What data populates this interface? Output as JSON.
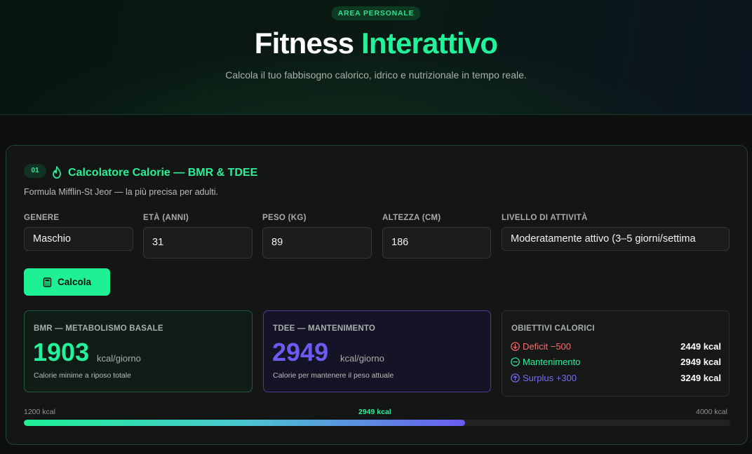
{
  "hero": {
    "badge": "AREA PERSONALE",
    "title_main": "Fitness",
    "title_accent": "Interattivo",
    "subtitle": "Calcola il tuo fabbisogno calorico, idrico e nutrizionale in tempo reale."
  },
  "calculator": {
    "step": "01",
    "icon": "flame-icon",
    "title": "Calcolatore Calorie — BMR & TDEE",
    "subtitle": "Formula Mifflin-St Jeor — la più precisa per adulti.",
    "fields": {
      "gender": {
        "label": "GENERE",
        "value": "Maschio"
      },
      "age": {
        "label": "ETÀ (ANNI)",
        "value": "31"
      },
      "weight": {
        "label": "PESO (KG)",
        "value": "89"
      },
      "height": {
        "label": "ALTEZZA (CM)",
        "value": "186"
      },
      "activity": {
        "label": "LIVELLO DI ATTIVITÀ",
        "value": "Moderatamente attivo (3–5 giorni/settima"
      }
    },
    "button": {
      "label": "Calcola",
      "icon": "calculator-icon"
    }
  },
  "results": {
    "bmr": {
      "label": "BMR — METABOLISMO BASALE",
      "value": "1903",
      "unit": "kcal/giorno",
      "caption": "Calorie minime a riposo totale"
    },
    "tdee": {
      "label": "TDEE — MANTENIMENTO",
      "value": "2949",
      "unit": "kcal/giorno",
      "caption": "Calorie per mantenere il peso attuale"
    },
    "goals": {
      "label": "OBIETTIVI CALORICI",
      "items": [
        {
          "name": "Deficit −500",
          "value": "2449 kcal",
          "icon": "arrow-down-circle-icon",
          "color": "#ff6b6b"
        },
        {
          "name": "Mantenimento",
          "value": "2949 kcal",
          "icon": "minus-circle-icon",
          "color": "#2bef98"
        },
        {
          "name": "Surplus +300",
          "value": "3249 kcal",
          "icon": "arrow-up-circle-icon",
          "color": "#7c6cf5"
        }
      ]
    }
  },
  "range": {
    "min_label": "1200 kcal",
    "max_label": "4000 kcal",
    "current_label": "2949 kcal",
    "fill_fraction": 0.625
  },
  "colors": {
    "accent": "#2bef98",
    "purple": "#6a5cf0",
    "deficit": "#ff6b6b"
  }
}
